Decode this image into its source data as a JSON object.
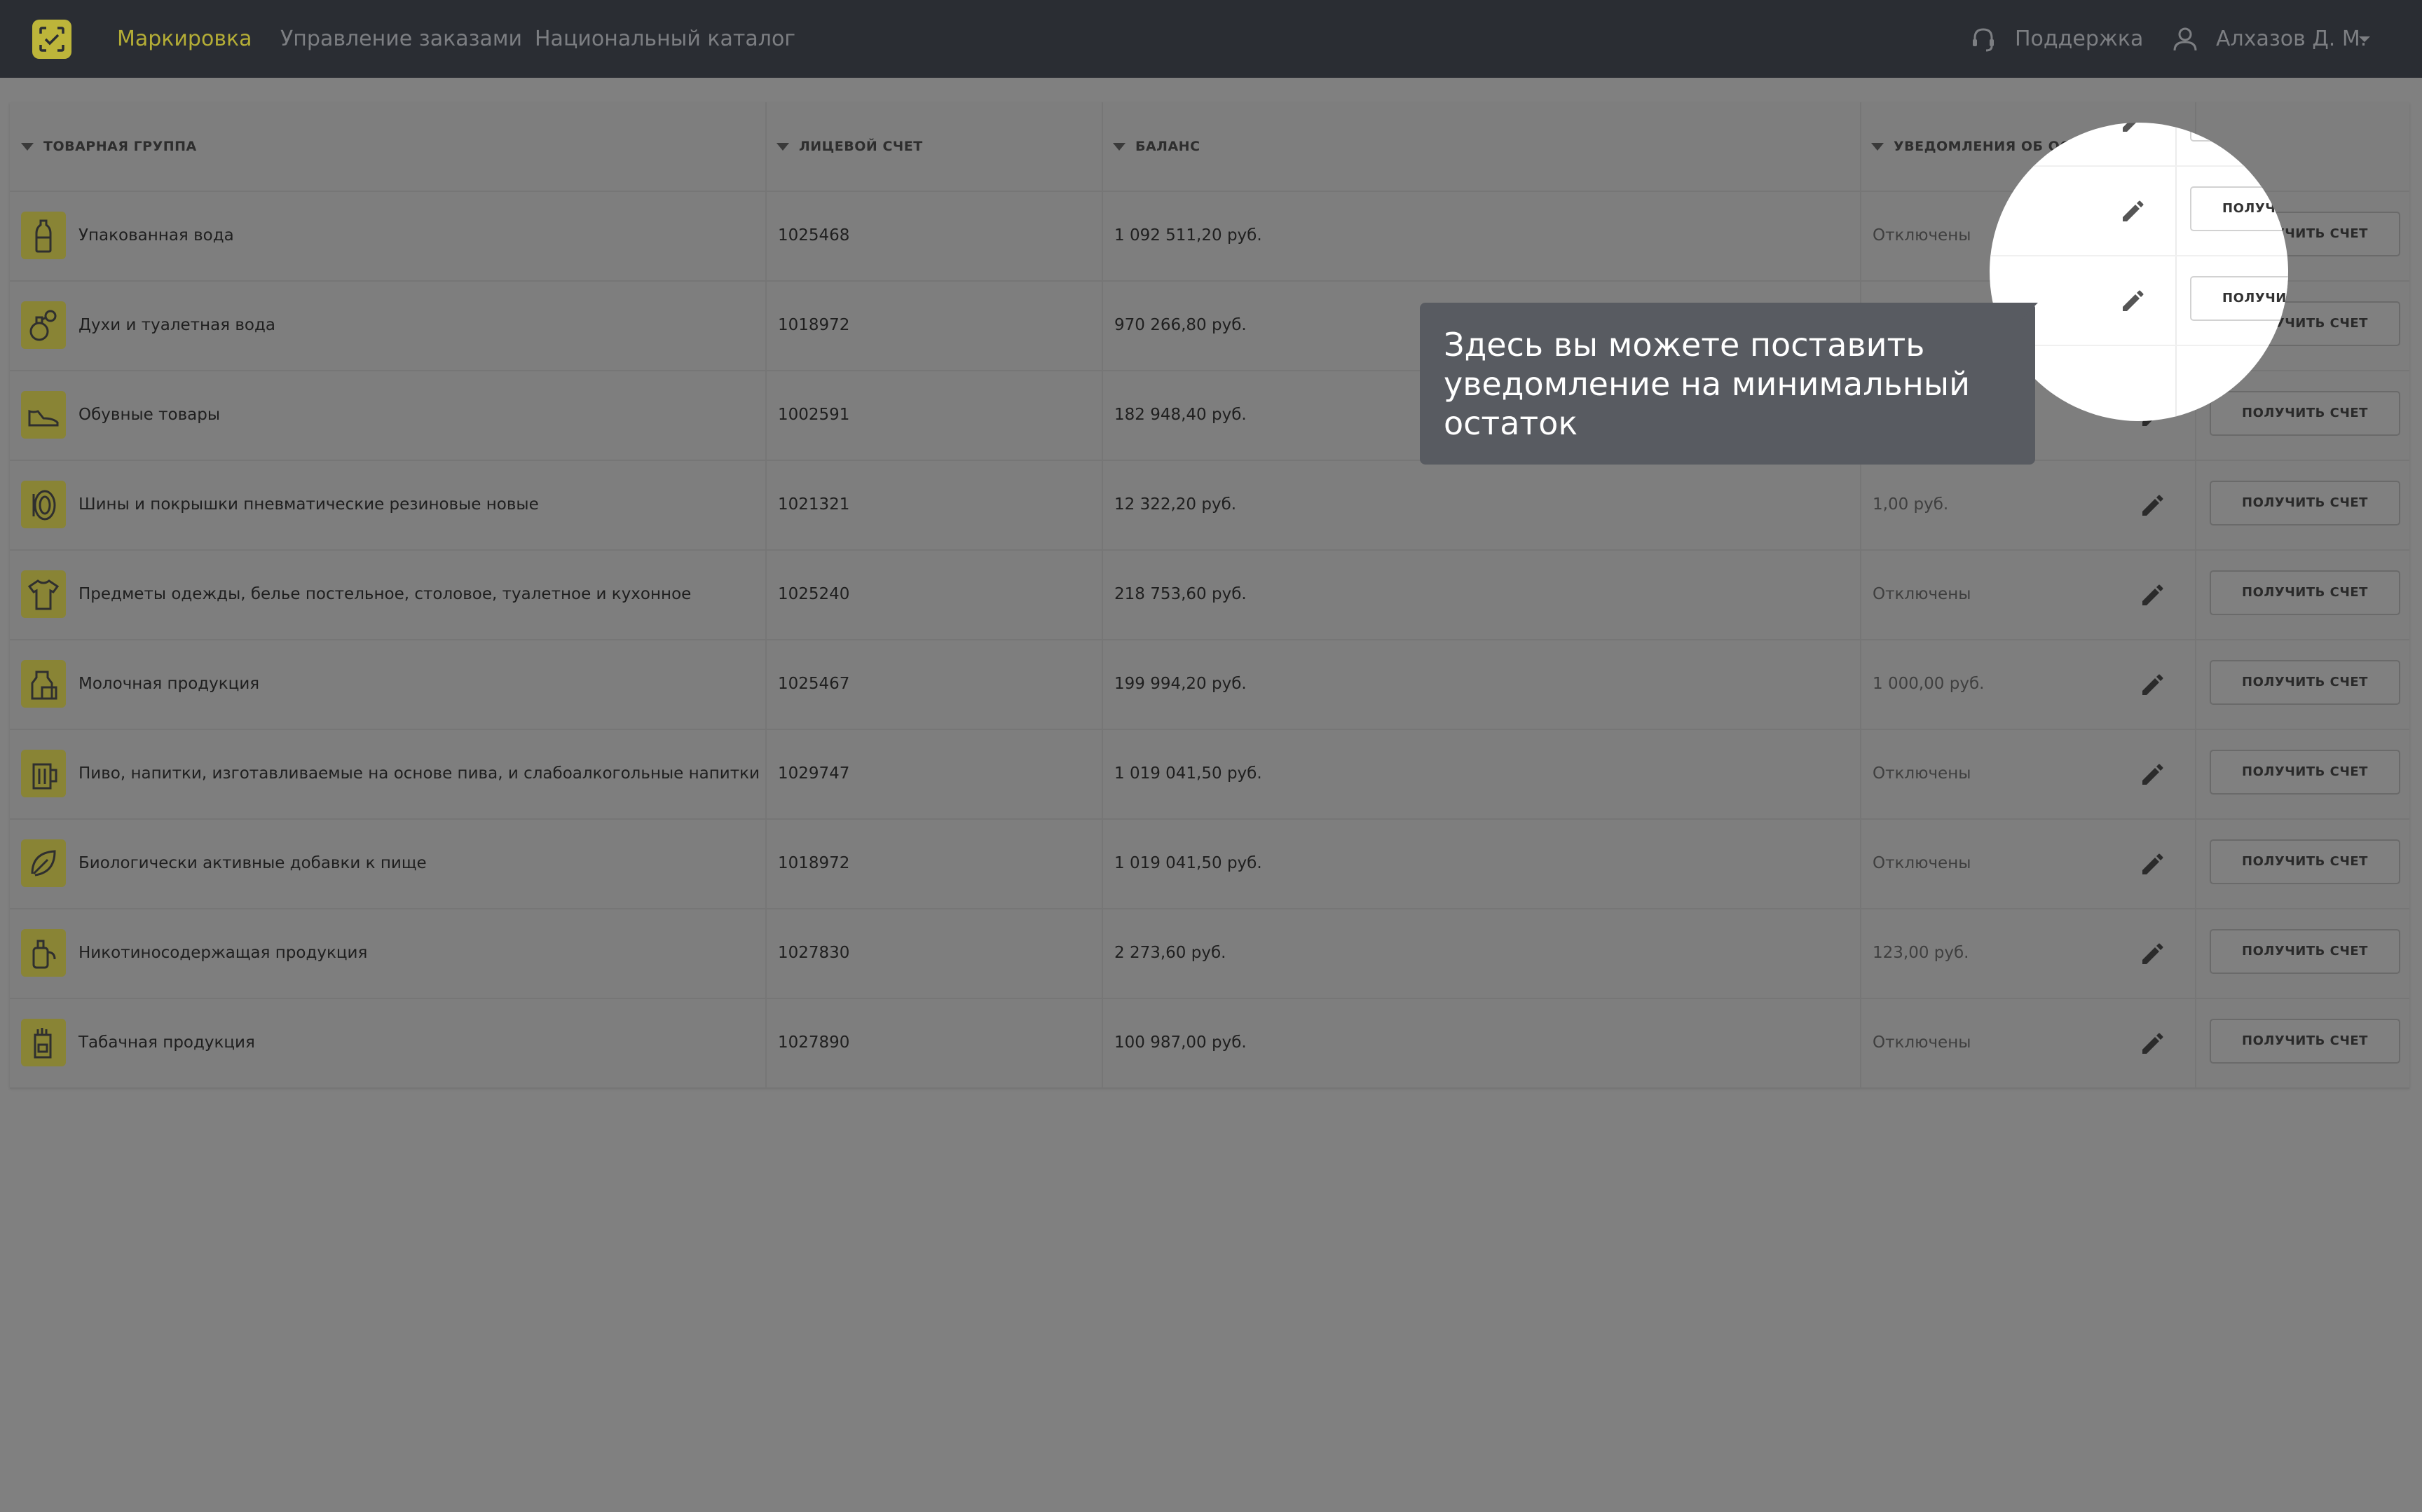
{
  "nav": {
    "items": [
      "Маркировка",
      "Управление заказами",
      "Национальный каталог"
    ],
    "support_label": "Поддержка",
    "user_name": "Алхазов Д. М."
  },
  "table": {
    "columns": [
      "ТОВАРНАЯ ГРУППА",
      "ЛИЦЕВОЙ СЧЕТ",
      "БАЛАНС",
      "УВЕДОМЛЕНИЯ ОБ ОСТАТКЕ"
    ],
    "invoice_label": "ПОЛУЧИТЬ СЧЕТ",
    "rows": [
      {
        "icon": "bottle-icon",
        "group": "Упакованная вода",
        "account": "1025468",
        "balance": "1 092 511,20 руб.",
        "notification": "Отключены"
      },
      {
        "icon": "perfume-icon",
        "group": "Духи и туалетная вода",
        "account": "1018972",
        "balance": "970 266,80 руб.",
        "notification": ""
      },
      {
        "icon": "shoe-icon",
        "group": "Обувные товары",
        "account": "1002591",
        "balance": "182 948,40 руб.",
        "notification": ""
      },
      {
        "icon": "tire-icon",
        "group": "Шины и покрышки пневматические резиновые новые",
        "account": "1021321",
        "balance": "12 322,20 руб.",
        "notification": "1,00 руб."
      },
      {
        "icon": "shirt-icon",
        "group": "Предметы одежды, белье постельное, столовое, туалетное и кухонное",
        "account": "1025240",
        "balance": "218 753,60 руб.",
        "notification": "Отключены"
      },
      {
        "icon": "milk-icon",
        "group": "Молочная продукция",
        "account": "1025467",
        "balance": "199 994,20 руб.",
        "notification": "1 000,00 руб."
      },
      {
        "icon": "beer-icon",
        "group": "Пиво, напитки, изготавливаемые на основе пива, и слабоалкогольные напитки",
        "account": "1029747",
        "balance": "1 019 041,50 руб.",
        "notification": "Отключены"
      },
      {
        "icon": "leaf-icon",
        "group": "Биологически активные добавки к пище",
        "account": "1018972",
        "balance": "1 019 041,50 руб.",
        "notification": "Отключены"
      },
      {
        "icon": "vape-icon",
        "group": "Никотиносодержащая продукция",
        "account": "1027830",
        "balance": "2 273,60 руб.",
        "notification": "123,00 руб."
      },
      {
        "icon": "cigarette-pack-icon",
        "group": "Табачная продукция",
        "account": "1027890",
        "balance": "100 987,00 руб.",
        "notification": "Отключены"
      }
    ]
  },
  "tooltip": {
    "text": "Здесь вы можете поставить уведомление на минимальный остаток"
  },
  "colors": {
    "topbar": "#2a2d33",
    "accent": "#b4ad36",
    "overlay": "#808080",
    "tooltip": "#585b61"
  }
}
